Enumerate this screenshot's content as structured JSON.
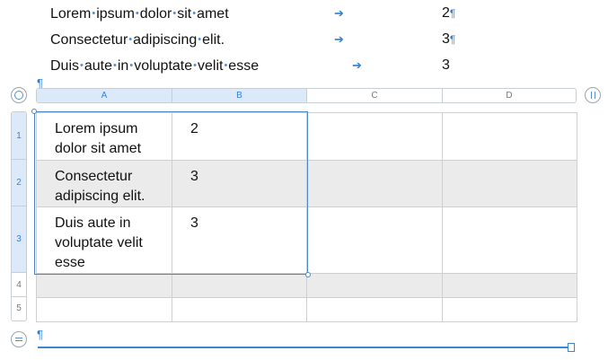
{
  "document": {
    "lines": [
      {
        "words": [
          "Lorem",
          "ipsum",
          "dolor",
          "sit",
          "amet"
        ],
        "arrow": "➔",
        "number": "2",
        "pilcrow": "¶"
      },
      {
        "words": [
          "Consectetur",
          "adipiscing",
          "elit."
        ],
        "arrow": "➔",
        "number": "3",
        "pilcrow": "¶"
      },
      {
        "words": [
          "Duis",
          "aute",
          "in",
          "voluptate",
          "velit",
          "esse"
        ],
        "arrow": "➔",
        "number": "3",
        "pilcrow": ""
      }
    ],
    "space_marker": "•",
    "paragraph_mark": "¶",
    "bottom_mark": "¶"
  },
  "table": {
    "columns": [
      "A",
      "B",
      "C",
      "D"
    ],
    "selected_columns": [
      "A",
      "B"
    ],
    "row_numbers": [
      "1",
      "2",
      "3",
      "4",
      "5"
    ],
    "selected_rows": [
      "1",
      "2",
      "3"
    ],
    "rows": [
      [
        "Lorem ipsum dolor sit amet",
        "2",
        "",
        ""
      ],
      [
        "Consectetur adipiscing elit.",
        "3",
        "",
        ""
      ],
      [
        "Duis aute in voluptate velit esse",
        "3",
        "",
        ""
      ],
      [
        "",
        "",
        "",
        ""
      ],
      [
        "",
        "",
        "",
        ""
      ]
    ]
  },
  "colors": {
    "accent": "#3f86cf",
    "selection_fill": "#dce9f8",
    "shaded_row": "#ebebeb"
  }
}
